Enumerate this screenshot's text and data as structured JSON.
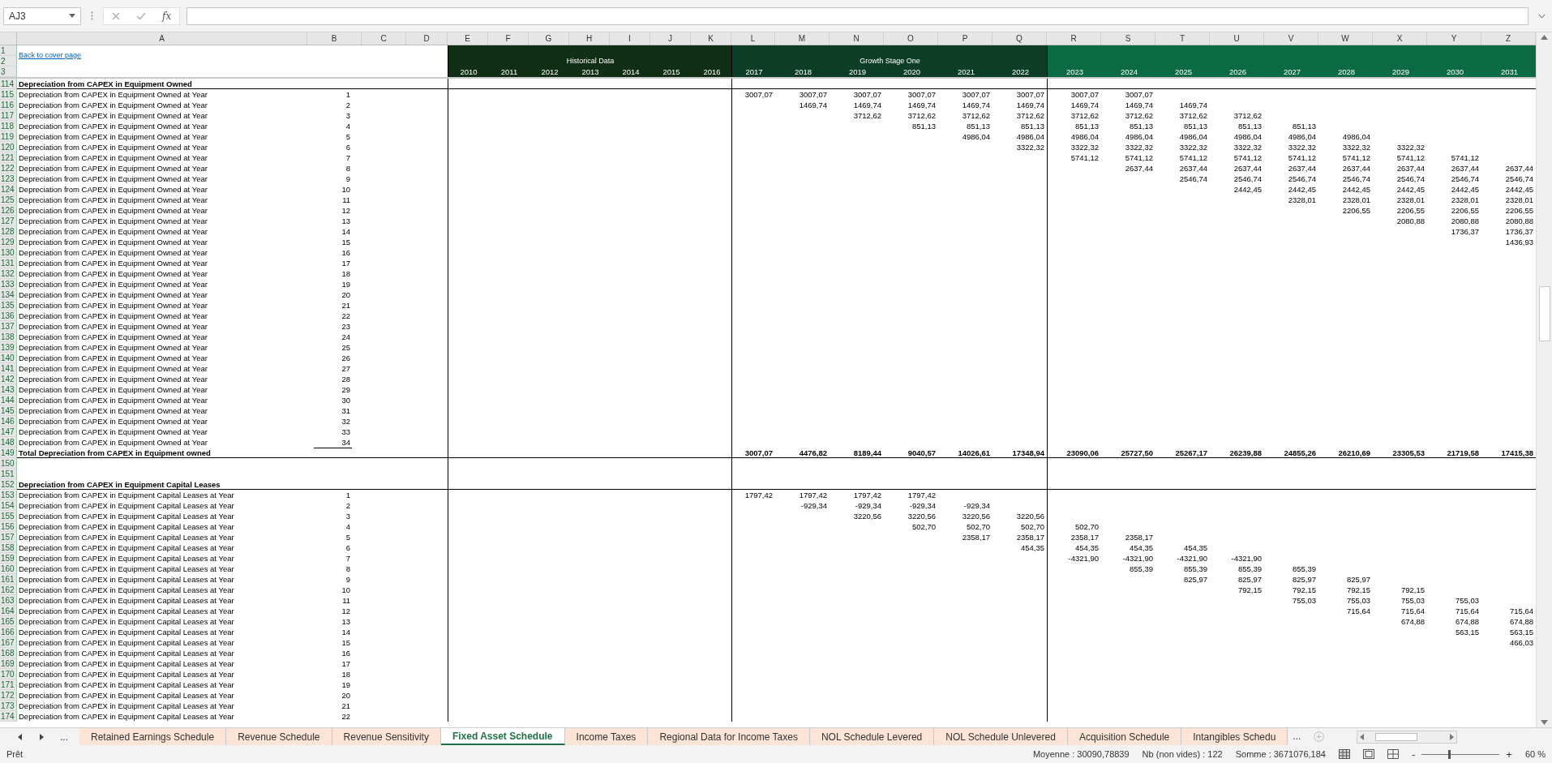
{
  "formula_bar": {
    "name_box": "AJ3",
    "function_label": "fx"
  },
  "columns": [
    "A",
    "B",
    "C",
    "D",
    "E",
    "F",
    "G",
    "H",
    "I",
    "J",
    "K",
    "L",
    "M",
    "N",
    "O",
    "P",
    "Q",
    "R",
    "S",
    "T",
    "U",
    "V",
    "W",
    "X",
    "Y",
    "Z"
  ],
  "header": {
    "row_numbers": [
      "1",
      "2",
      "3"
    ],
    "link": "Back to cover page",
    "bands": [
      {
        "title": "Historical Data",
        "color": "#0f2e14",
        "years": [
          "2010",
          "2011",
          "2012",
          "2013",
          "2014",
          "2015",
          "2016"
        ]
      },
      {
        "title": "Growth Stage One",
        "color": "#0c3d27",
        "years": [
          "2017",
          "2018",
          "2019",
          "2020",
          "2021",
          "2022"
        ]
      },
      {
        "color": "#0a6a44",
        "years": [
          "2023",
          "2024",
          "2025",
          "2026",
          "2027",
          "2028",
          "2029",
          "2030",
          "2031"
        ]
      }
    ]
  },
  "rows": [
    {
      "number": "114",
      "kind": "section",
      "label": "Depreciation from CAPEX in Equipment Owned"
    },
    {
      "number": "115",
      "kind": "item",
      "label": "Depreciation from CAPEX in Equipment Owned at Year",
      "year": "1",
      "values": [
        "3007,07",
        "3007,07",
        "3007,07",
        "3007,07",
        "3007,07",
        "3007,07",
        "3007,07",
        "3007,07"
      ]
    },
    {
      "number": "116",
      "kind": "item",
      "label": "Depreciation from CAPEX in Equipment Owned at Year",
      "year": "2",
      "values": [
        "1469,74",
        "1469,74",
        "1469,74",
        "1469,74",
        "1469,74",
        "1469,74",
        "1469,74",
        "1469,74"
      ]
    },
    {
      "number": "117",
      "kind": "item",
      "label": "Depreciation from CAPEX in Equipment Owned at Year",
      "year": "3",
      "values": [
        "3712,62",
        "3712,62",
        "3712,62",
        "3712,62",
        "3712,62",
        "3712,62",
        "3712,62",
        "3712,62"
      ]
    },
    {
      "number": "118",
      "kind": "item",
      "label": "Depreciation from CAPEX in Equipment Owned at Year",
      "year": "4",
      "values": [
        "851,13",
        "851,13",
        "851,13",
        "851,13",
        "851,13",
        "851,13",
        "851,13",
        "851,13"
      ]
    },
    {
      "number": "119",
      "kind": "item",
      "label": "Depreciation from CAPEX in Equipment Owned at Year",
      "year": "5",
      "values": [
        "4986,04",
        "4986,04",
        "4986,04",
        "4986,04",
        "4986,04",
        "4986,04",
        "4986,04",
        "4986,04"
      ]
    },
    {
      "number": "120",
      "kind": "item",
      "label": "Depreciation from CAPEX in Equipment Owned at Year",
      "year": "6",
      "values": [
        "3322,32",
        "3322,32",
        "3322,32",
        "3322,32",
        "3322,32",
        "3322,32",
        "3322,32",
        "3322,32"
      ]
    },
    {
      "number": "121",
      "kind": "item",
      "label": "Depreciation from CAPEX in Equipment Owned at Year",
      "year": "7",
      "values": [
        "5741,12",
        "5741,12",
        "5741,12",
        "5741,12",
        "5741,12",
        "5741,12",
        "5741,12",
        "5741,12"
      ]
    },
    {
      "number": "122",
      "kind": "item",
      "label": "Depreciation from CAPEX in Equipment Owned at Year",
      "year": "8",
      "values": [
        "2637,44",
        "2637,44",
        "2637,44",
        "2637,44",
        "2637,44",
        "2637,44",
        "2637,44",
        "2637,44"
      ]
    },
    {
      "number": "123",
      "kind": "item",
      "label": "Depreciation from CAPEX in Equipment Owned at Year",
      "year": "9",
      "values": [
        "2546,74",
        "2546,74",
        "2546,74",
        "2546,74",
        "2546,74",
        "2546,74",
        "2546,74"
      ]
    },
    {
      "number": "124",
      "kind": "item",
      "label": "Depreciation from CAPEX in Equipment Owned at Year",
      "year": "10",
      "values": [
        "2442,45",
        "2442,45",
        "2442,45",
        "2442,45",
        "2442,45",
        "2442,45"
      ]
    },
    {
      "number": "125",
      "kind": "item",
      "label": "Depreciation from CAPEX in Equipment Owned at Year",
      "year": "11",
      "values": [
        "2328,01",
        "2328,01",
        "2328,01",
        "2328,01",
        "2328,01"
      ]
    },
    {
      "number": "126",
      "kind": "item",
      "label": "Depreciation from CAPEX in Equipment Owned at Year",
      "year": "12",
      "values": [
        "2206,55",
        "2206,55",
        "2206,55",
        "2206,55"
      ]
    },
    {
      "number": "127",
      "kind": "item",
      "label": "Depreciation from CAPEX in Equipment Owned at Year",
      "year": "13",
      "values": [
        "2080,88",
        "2080,88",
        "2080,88"
      ]
    },
    {
      "number": "128",
      "kind": "item",
      "label": "Depreciation from CAPEX in Equipment Owned at Year",
      "year": "14",
      "values": [
        "1736,37",
        "1736,37"
      ]
    },
    {
      "number": "129",
      "kind": "item",
      "label": "Depreciation from CAPEX in Equipment Owned at Year",
      "year": "15",
      "values": [
        "1436,93"
      ]
    },
    {
      "number": "130",
      "kind": "item",
      "label": "Depreciation from CAPEX in Equipment Owned at Year",
      "year": "16"
    },
    {
      "number": "131",
      "kind": "item",
      "label": "Depreciation from CAPEX in Equipment Owned at Year",
      "year": "17"
    },
    {
      "number": "132",
      "kind": "item",
      "label": "Depreciation from CAPEX in Equipment Owned at Year",
      "year": "18"
    },
    {
      "number": "133",
      "kind": "item",
      "label": "Depreciation from CAPEX in Equipment Owned at Year",
      "year": "19"
    },
    {
      "number": "134",
      "kind": "item",
      "label": "Depreciation from CAPEX in Equipment Owned at Year",
      "year": "20"
    },
    {
      "number": "135",
      "kind": "item",
      "label": "Depreciation from CAPEX in Equipment Owned at Year",
      "year": "21"
    },
    {
      "number": "136",
      "kind": "item",
      "label": "Depreciation from CAPEX in Equipment Owned at Year",
      "year": "22"
    },
    {
      "number": "137",
      "kind": "item",
      "label": "Depreciation from CAPEX in Equipment Owned at Year",
      "year": "23"
    },
    {
      "number": "138",
      "kind": "item",
      "label": "Depreciation from CAPEX in Equipment Owned at Year",
      "year": "24"
    },
    {
      "number": "139",
      "kind": "item",
      "label": "Depreciation from CAPEX in Equipment Owned at Year",
      "year": "25"
    },
    {
      "number": "140",
      "kind": "item",
      "label": "Depreciation from CAPEX in Equipment Owned at Year",
      "year": "26"
    },
    {
      "number": "141",
      "kind": "item",
      "label": "Depreciation from CAPEX in Equipment Owned at Year",
      "year": "27"
    },
    {
      "number": "142",
      "kind": "item",
      "label": "Depreciation from CAPEX in Equipment Owned at Year",
      "year": "28"
    },
    {
      "number": "143",
      "kind": "item",
      "label": "Depreciation from CAPEX in Equipment Owned at Year",
      "year": "29"
    },
    {
      "number": "144",
      "kind": "item",
      "label": "Depreciation from CAPEX in Equipment Owned at Year",
      "year": "30"
    },
    {
      "number": "145",
      "kind": "item",
      "label": "Depreciation from CAPEX in Equipment Owned at Year",
      "year": "31"
    },
    {
      "number": "146",
      "kind": "item",
      "label": "Depreciation from CAPEX in Equipment Owned at Year",
      "year": "32"
    },
    {
      "number": "147",
      "kind": "item",
      "label": "Depreciation from CAPEX in Equipment Owned at Year",
      "year": "33"
    },
    {
      "number": "148",
      "kind": "item",
      "label": "Depreciation from CAPEX in Equipment Owned at Year",
      "year": "34"
    },
    {
      "number": "149",
      "kind": "total",
      "label": "Total Depreciation from CAPEX in Equipment owned",
      "values": [
        "3007,07",
        "4476,82",
        "8189,44",
        "9040,57",
        "14026,61",
        "17348,94",
        "23090,06",
        "25727,50",
        "25267,17",
        "26239,88",
        "24855,26",
        "26210,69",
        "23305,53",
        "21719,58",
        "17415,38"
      ]
    },
    {
      "number": "150",
      "kind": "blank"
    },
    {
      "number": "151",
      "kind": "blank"
    },
    {
      "number": "152",
      "kind": "section",
      "label": "Depreciation from CAPEX in Equipment Capital Leases"
    },
    {
      "number": "153",
      "kind": "item",
      "label": "Depreciation from CAPEX in Equipment Capital Leases at Year",
      "year": "1",
      "values": [
        "1797,42",
        "1797,42",
        "1797,42",
        "1797,42"
      ]
    },
    {
      "number": "154",
      "kind": "item",
      "label": "Depreciation from CAPEX in Equipment Capital Leases at Year",
      "year": "2",
      "values": [
        "-929,34",
        "-929,34",
        "-929,34",
        "-929,34"
      ]
    },
    {
      "number": "155",
      "kind": "item",
      "label": "Depreciation from CAPEX in Equipment Capital Leases at Year",
      "year": "3",
      "values": [
        "3220,56",
        "3220,56",
        "3220,56",
        "3220,56"
      ]
    },
    {
      "number": "156",
      "kind": "item",
      "label": "Depreciation from CAPEX in Equipment Capital Leases at Year",
      "year": "4",
      "values": [
        "502,70",
        "502,70",
        "502,70",
        "502,70"
      ]
    },
    {
      "number": "157",
      "kind": "item",
      "label": "Depreciation from CAPEX in Equipment Capital Leases at Year",
      "year": "5",
      "values": [
        "2358,17",
        "2358,17",
        "2358,17",
        "2358,17"
      ]
    },
    {
      "number": "158",
      "kind": "item",
      "label": "Depreciation from CAPEX in Equipment Capital Leases at Year",
      "year": "6",
      "values": [
        "454,35",
        "454,35",
        "454,35",
        "454,35"
      ]
    },
    {
      "number": "159",
      "kind": "item",
      "label": "Depreciation from CAPEX in Equipment Capital Leases at Year",
      "year": "7",
      "values": [
        "-4321,90",
        "-4321,90",
        "-4321,90",
        "-4321,90"
      ]
    },
    {
      "number": "160",
      "kind": "item",
      "label": "Depreciation from CAPEX in Equipment Capital Leases at Year",
      "year": "8",
      "values": [
        "855,39",
        "855,39",
        "855,39",
        "855,39"
      ]
    },
    {
      "number": "161",
      "kind": "item",
      "label": "Depreciation from CAPEX in Equipment Capital Leases at Year",
      "year": "9",
      "values": [
        "825,97",
        "825,97",
        "825,97",
        "825,97"
      ]
    },
    {
      "number": "162",
      "kind": "item",
      "label": "Depreciation from CAPEX in Equipment Capital Leases at Year",
      "year": "10",
      "values": [
        "792,15",
        "792,15",
        "792,15",
        "792,15"
      ]
    },
    {
      "number": "163",
      "kind": "item",
      "label": "Depreciation from CAPEX in Equipment Capital Leases at Year",
      "year": "11",
      "values": [
        "755,03",
        "755,03",
        "755,03",
        "755,03"
      ]
    },
    {
      "number": "164",
      "kind": "item",
      "label": "Depreciation from CAPEX in Equipment Capital Leases at Year",
      "year": "12",
      "values": [
        "715,64",
        "715,64",
        "715,64",
        "715,64"
      ]
    },
    {
      "number": "165",
      "kind": "item",
      "label": "Depreciation from CAPEX in Equipment Capital Leases at Year",
      "year": "13",
      "values": [
        "674,88",
        "674,88",
        "674,88"
      ]
    },
    {
      "number": "166",
      "kind": "item",
      "label": "Depreciation from CAPEX in Equipment Capital Leases at Year",
      "year": "14",
      "values": [
        "563,15",
        "563,15"
      ]
    },
    {
      "number": "167",
      "kind": "item",
      "label": "Depreciation from CAPEX in Equipment Capital Leases at Year",
      "year": "15",
      "values": [
        "466,03"
      ]
    },
    {
      "number": "168",
      "kind": "item",
      "label": "Depreciation from CAPEX in Equipment Capital Leases at Year",
      "year": "16"
    },
    {
      "number": "169",
      "kind": "item",
      "label": "Depreciation from CAPEX in Equipment Capital Leases at Year",
      "year": "17"
    },
    {
      "number": "170",
      "kind": "item",
      "label": "Depreciation from CAPEX in Equipment Capital Leases at Year",
      "year": "18"
    },
    {
      "number": "171",
      "kind": "item",
      "label": "Depreciation from CAPEX in Equipment Capital Leases at Year",
      "year": "19"
    },
    {
      "number": "172",
      "kind": "item",
      "label": "Depreciation from CAPEX in Equipment Capital Leases at Year",
      "year": "20"
    },
    {
      "number": "173",
      "kind": "item",
      "label": "Depreciation from CAPEX in Equipment Capital Leases at Year",
      "year": "21"
    },
    {
      "number": "174",
      "kind": "item",
      "label": "Depreciation from CAPEX in Equipment Capital Leases at Year",
      "year": "22"
    }
  ],
  "sheet_tabs": {
    "more": "...",
    "tabs": [
      {
        "label": "Retained Earnings Schedule",
        "selected": false
      },
      {
        "label": "Revenue Schedule",
        "selected": false
      },
      {
        "label": "Revenue Sensitivity",
        "selected": false
      },
      {
        "label": "Fixed Asset Schedule",
        "selected": true
      },
      {
        "label": "Income Taxes",
        "selected": false
      },
      {
        "label": "Regional Data for Income Taxes",
        "selected": false
      },
      {
        "label": "NOL Schedule Levered",
        "selected": false
      },
      {
        "label": "NOL Schedule Unlevered",
        "selected": false
      },
      {
        "label": "Acquisition Schedule",
        "selected": false
      },
      {
        "label": "Intangibles Schedu",
        "selected": false
      }
    ],
    "overflow": "..."
  },
  "status_bar": {
    "ready": "Prêt",
    "average": "Moyenne : 30090,78839",
    "count": "Nb (non vides) : 122",
    "sum": "Somme : 3671076,184",
    "zoom_out": "-",
    "zoom_in": "+",
    "zoom": "60 %",
    "zoom_slider": {
      "level": 0.35
    }
  }
}
